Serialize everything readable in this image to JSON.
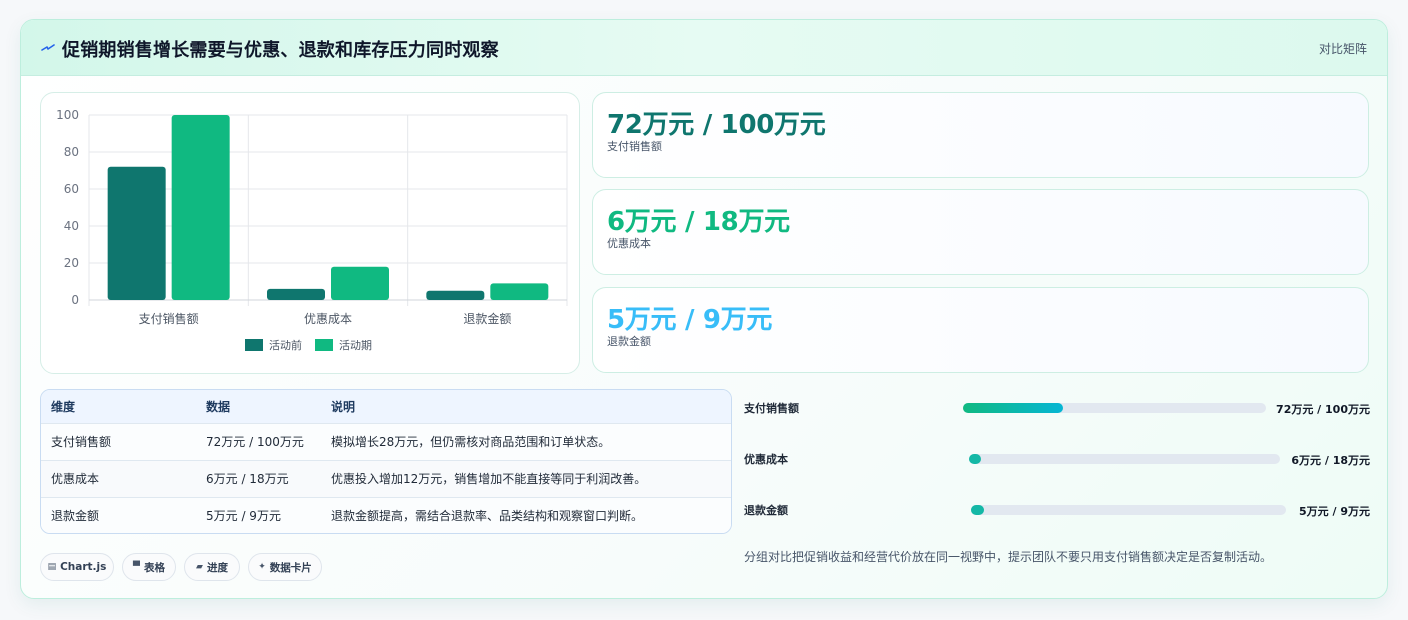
{
  "header": {
    "icon": "spark-icon",
    "title": "促销期销售增长需要与优惠、退款和库存压力同时观察",
    "action_label": "对比矩阵"
  },
  "colors": {
    "before": "#0f766e",
    "during": "#10b981",
    "kpi_sales": "#0f766e",
    "kpi_discount": "#10b981",
    "kpi_refund": "#38bdf8",
    "progress_sales": "#14b8a6",
    "progress_other": "#14b8a6"
  },
  "chart_data": {
    "type": "bar",
    "categories": [
      "支付销售额",
      "优惠成本",
      "退款金额"
    ],
    "series": [
      {
        "name": "活动前",
        "values": [
          72,
          6,
          5
        ]
      },
      {
        "name": "活动期",
        "values": [
          100,
          18,
          9
        ]
      }
    ],
    "y_ticks": [
      "0",
      "20",
      "40",
      "60",
      "80",
      "100"
    ],
    "ylim": [
      0,
      100
    ],
    "grid": true,
    "legend": "bottom"
  },
  "kpis": [
    {
      "value": "72万元 / 100万元",
      "label": "支付销售额"
    },
    {
      "value": "6万元 / 18万元",
      "label": "优惠成本"
    },
    {
      "value": "5万元 / 9万元",
      "label": "退款金额"
    }
  ],
  "table": {
    "headers": [
      "维度",
      "数据",
      "说明"
    ],
    "rows": [
      [
        "支付销售额",
        "72万元 / 100万元",
        "模拟增长28万元，但仍需核对商品范围和订单状态。"
      ],
      [
        "优惠成本",
        "6万元 / 18万元",
        "优惠投入增加12万元，销售增加不能直接等同于利润改善。"
      ],
      [
        "退款金额",
        "5万元 / 9万元",
        "退款金额提高，需结合退款率、品类结构和观察窗口判断。"
      ]
    ]
  },
  "progress": [
    {
      "label": "支付销售额",
      "value_text": "72万元 / 100万元",
      "fraction": 0.33
    },
    {
      "label": "优惠成本",
      "value_text": "6万元 / 18万元",
      "fraction": 0.04
    },
    {
      "label": "退款金额",
      "value_text": "5万元 / 9万元",
      "fraction": 0.04
    }
  ],
  "note": "分组对比把促销收益和经营代价放在同一视野中，提示团队不要只用支付销售额决定是否复制活动。",
  "chips": [
    {
      "icon": "chart-icon",
      "glyph": "▤",
      "label": "Chart.js"
    },
    {
      "icon": "table-icon",
      "glyph": "▀",
      "label": "表格"
    },
    {
      "icon": "progress-icon",
      "glyph": "▰",
      "label": "进度"
    },
    {
      "icon": "sparkle-icon",
      "glyph": "✦",
      "label": "数据卡片"
    }
  ]
}
